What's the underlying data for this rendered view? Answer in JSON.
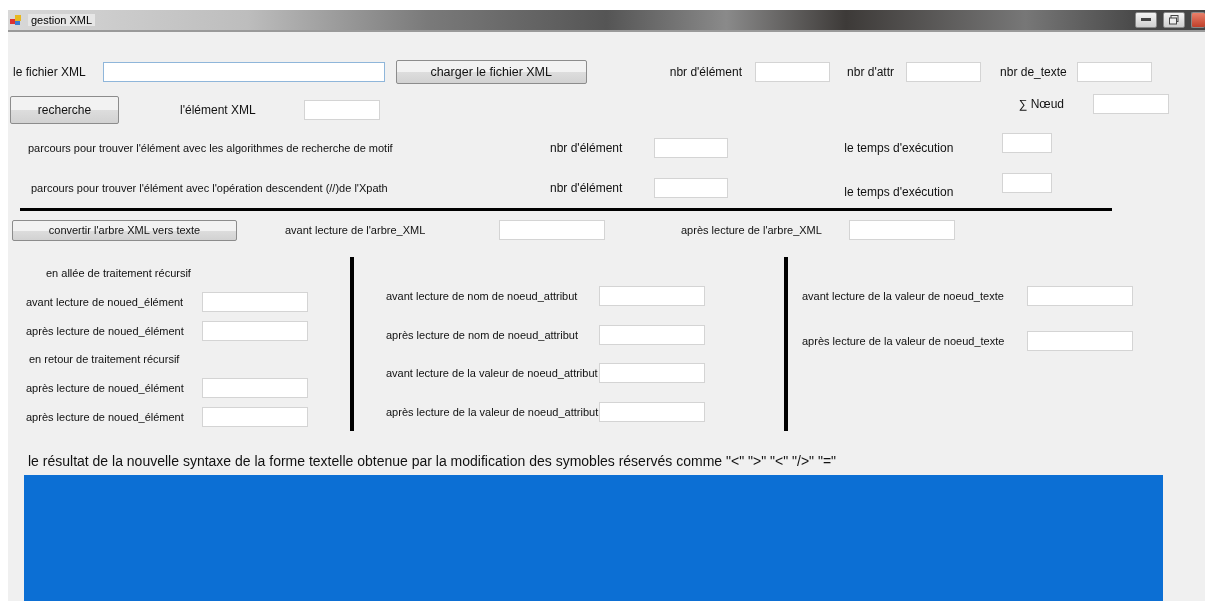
{
  "window": {
    "title": "gestion XML"
  },
  "file_row": {
    "label": "le fichier XML",
    "button": "charger le fichier XML",
    "counts": [
      {
        "label": "nbr d'élément"
      },
      {
        "label": "nbr d'attr"
      },
      {
        "label": "nbr de_texte"
      }
    ]
  },
  "search_row": {
    "button": "recherche",
    "label": "l'élément XML",
    "total_label": "∑ Nœud"
  },
  "traversals": [
    {
      "label": "parcours pour trouver l'élément avec les algorithmes  de recherche de motif",
      "count_label": "nbr d'élément",
      "time_label": "le temps d'exécution"
    },
    {
      "label": "parcours pour trouver l'élément avec l'opération descendent (//)de l'Xpath",
      "count_label": "nbr d'élément",
      "time_label": "le temps d'exécution"
    }
  ],
  "convert_row": {
    "button": "convertir l'arbre XML vers texte",
    "before_label": "avant lecture de l'arbre_XML",
    "after_label": "après lecture de l'arbre_XML"
  },
  "columns": [
    {
      "items": [
        {
          "kind": "heading",
          "label": "en allée de traitement récursif"
        },
        {
          "kind": "field",
          "label": "avant lecture de noued_élément"
        },
        {
          "kind": "field",
          "label": "après lecture de noued_élément"
        },
        {
          "kind": "heading",
          "label": "en retour de traitement récursif"
        },
        {
          "kind": "field",
          "label": "après lecture de noued_élément"
        },
        {
          "kind": "field",
          "label": "après lecture de noued_élément"
        }
      ]
    },
    {
      "items": [
        {
          "kind": "field",
          "label": "avant lecture de nom de noeud_attribut"
        },
        {
          "kind": "field",
          "label": "après lecture de nom de noeud_attribut"
        },
        {
          "kind": "field",
          "label": "avant lecture de la valeur de noeud_attribut"
        },
        {
          "kind": "field",
          "label": "après lecture de la valeur de noeud_attribut"
        }
      ]
    },
    {
      "items": [
        {
          "kind": "field",
          "label": "avant lecture de la valeur de noeud_texte"
        },
        {
          "kind": "field",
          "label": "après lecture de la valeur de noeud_texte"
        }
      ]
    }
  ],
  "result": {
    "label": "le résultat de la nouvelle syntaxe de la  forme textelle obtenue par la modification des symobles réservés comme \"<\"  \">\" \"<\"  \"/>\" \"=\""
  }
}
